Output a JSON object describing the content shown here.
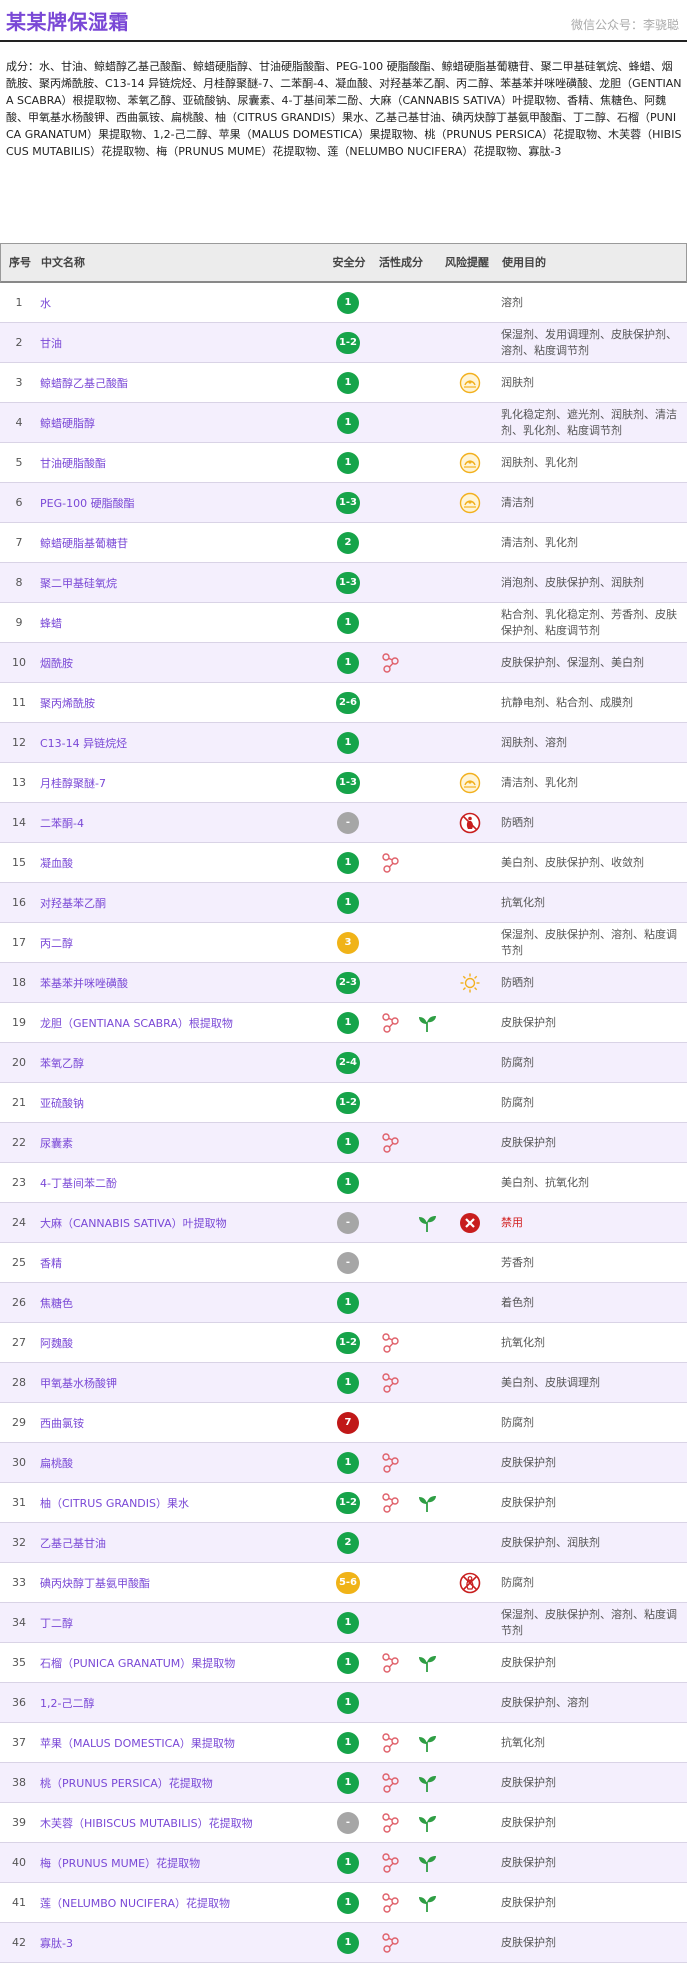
{
  "header": {
    "title": "某某牌保湿霜",
    "credit": "微信公众号：李骁聪"
  },
  "ingredients_text": "成分：水、甘油、鲸蜡醇乙基己酸酯、鲸蜡硬脂醇、甘油硬脂酸酯、PEG-100 硬脂酸酯、鲸蜡硬脂基葡糖苷、聚二甲基硅氧烷、蜂蜡、烟酰胺、聚丙烯酰胺、C13-14 异链烷烃、月桂醇聚醚-7、二苯酮-4、凝血酸、对羟基苯乙酮、丙二醇、苯基苯并咪唑磺酸、龙胆（GENTIANA SCABRA）根提取物、苯氧乙醇、亚硫酸钠、尿囊素、4-丁基间苯二酚、大麻（CANNABIS SATIVA）叶提取物、香精、焦糖色、阿魏酸、甲氧基水杨酸钾、西曲氯铵、扁桃酸、柚（CITRUS GRANDIS）果水、乙基己基甘油、碘丙炔醇丁基氨甲酸酯、丁二醇、石榴（PUNICA GRANATUM）果提取物、1,2-己二醇、苹果（MALUS DOMESTICA）果提取物、桃（PRUNUS PERSICA）花提取物、木芙蓉（HIBISCUS MUTABILIS）花提取物、梅（PRUNUS MUME）花提取物、莲（NELUMBO NUCIFERA）花提取物、寡肽-3",
  "columns": {
    "no": "序号",
    "name": "中文名称",
    "score": "安全分",
    "active": "活性成分",
    "risk": "风险提醒",
    "purpose": "使用目的"
  },
  "colors": {
    "accent": "#7a48d6",
    "green": "#16a44a",
    "gray": "#a6a6a6",
    "yellow": "#f0b318",
    "red": "#c01818",
    "ban": "#d22222"
  },
  "rows": [
    {
      "no": "1",
      "name": "水",
      "score": "1",
      "score_color": "green",
      "active": [],
      "risk": "",
      "purpose": "溶剂"
    },
    {
      "no": "2",
      "name": "甘油",
      "score": "1-2",
      "score_color": "green",
      "active": [],
      "risk": "",
      "purpose": "保湿剂、发用调理剂、皮肤保护剂、溶剂、粘度调节剂"
    },
    {
      "no": "3",
      "name": "鲸蜡醇乙基己酸酯",
      "score": "1",
      "score_color": "green",
      "active": [],
      "risk": "acne-icon",
      "purpose": "润肤剂"
    },
    {
      "no": "4",
      "name": "鲸蜡硬脂醇",
      "score": "1",
      "score_color": "green",
      "active": [],
      "risk": "",
      "purpose": "乳化稳定剂、遮光剂、润肤剂、清洁剂、乳化剂、粘度调节剂"
    },
    {
      "no": "5",
      "name": "甘油硬脂酸酯",
      "score": "1",
      "score_color": "green",
      "active": [],
      "risk": "acne-icon",
      "purpose": "润肤剂、乳化剂"
    },
    {
      "no": "6",
      "name": "PEG-100 硬脂酸酯",
      "score": "1-3",
      "score_color": "green",
      "active": [],
      "risk": "acne-icon",
      "purpose": "清洁剂"
    },
    {
      "no": "7",
      "name": "鲸蜡硬脂基葡糖苷",
      "score": "2",
      "score_color": "green",
      "active": [],
      "risk": "",
      "purpose": "清洁剂、乳化剂"
    },
    {
      "no": "8",
      "name": "聚二甲基硅氧烷",
      "score": "1-3",
      "score_color": "green",
      "active": [],
      "risk": "",
      "purpose": "消泡剂、皮肤保护剂、润肤剂"
    },
    {
      "no": "9",
      "name": "蜂蜡",
      "score": "1",
      "score_color": "green",
      "active": [],
      "risk": "",
      "purpose": "粘合剂、乳化稳定剂、芳香剂、皮肤保护剂、粘度调节剂"
    },
    {
      "no": "10",
      "name": "烟酰胺",
      "score": "1",
      "score_color": "green",
      "active": [
        "molecule-icon"
      ],
      "risk": "",
      "purpose": "皮肤保护剂、保湿剂、美白剂"
    },
    {
      "no": "11",
      "name": "聚丙烯酰胺",
      "score": "2-6",
      "score_color": "green",
      "active": [],
      "risk": "",
      "purpose": "抗静电剂、粘合剂、成膜剂"
    },
    {
      "no": "12",
      "name": "C13-14 异链烷烃",
      "score": "1",
      "score_color": "green",
      "active": [],
      "risk": "",
      "purpose": "润肤剂、溶剂"
    },
    {
      "no": "13",
      "name": "月桂醇聚醚-7",
      "score": "1-3",
      "score_color": "green",
      "active": [],
      "risk": "acne-icon",
      "purpose": "清洁剂、乳化剂"
    },
    {
      "no": "14",
      "name": "二苯酮-4",
      "score": "-",
      "score_color": "gray",
      "active": [],
      "risk": "pregnancy-warning-icon",
      "purpose": "防晒剂"
    },
    {
      "no": "15",
      "name": "凝血酸",
      "score": "1",
      "score_color": "green",
      "active": [
        "molecule-icon"
      ],
      "risk": "",
      "purpose": "美白剂、皮肤保护剂、收敛剂"
    },
    {
      "no": "16",
      "name": "对羟基苯乙酮",
      "score": "1",
      "score_color": "green",
      "active": [],
      "risk": "",
      "purpose": "抗氧化剂"
    },
    {
      "no": "17",
      "name": "丙二醇",
      "score": "3",
      "score_color": "yellow",
      "active": [],
      "risk": "",
      "purpose": "保湿剂、皮肤保护剂、溶剂、粘度调节剂"
    },
    {
      "no": "18",
      "name": "苯基苯并咪唑磺酸",
      "score": "2-3",
      "score_color": "green",
      "active": [],
      "risk": "sun-icon",
      "purpose": "防晒剂"
    },
    {
      "no": "19",
      "name": "龙胆（GENTIANA SCABRA）根提取物",
      "score": "1",
      "score_color": "green",
      "active": [
        "molecule-icon",
        "plant-icon"
      ],
      "risk": "",
      "purpose": "皮肤保护剂"
    },
    {
      "no": "20",
      "name": "苯氧乙醇",
      "score": "2-4",
      "score_color": "green",
      "active": [],
      "risk": "",
      "purpose": "防腐剂"
    },
    {
      "no": "21",
      "name": "亚硫酸钠",
      "score": "1-2",
      "score_color": "green",
      "active": [],
      "risk": "",
      "purpose": "防腐剂"
    },
    {
      "no": "22",
      "name": "尿囊素",
      "score": "1",
      "score_color": "green",
      "active": [
        "molecule-icon"
      ],
      "risk": "",
      "purpose": "皮肤保护剂"
    },
    {
      "no": "23",
      "name": "4-丁基间苯二酚",
      "score": "1",
      "score_color": "green",
      "active": [],
      "risk": "",
      "purpose": "美白剂、抗氧化剂"
    },
    {
      "no": "24",
      "name": "大麻（CANNABIS SATIVA）叶提取物",
      "score": "-",
      "score_color": "gray",
      "active": [
        "",
        "plant-icon"
      ],
      "risk": "banned-icon",
      "purpose": "禁用",
      "ban": true
    },
    {
      "no": "25",
      "name": "香精",
      "score": "-",
      "score_color": "gray",
      "active": [],
      "risk": "",
      "purpose": "芳香剂"
    },
    {
      "no": "26",
      "name": "焦糖色",
      "score": "1",
      "score_color": "green",
      "active": [],
      "risk": "",
      "purpose": "着色剂"
    },
    {
      "no": "27",
      "name": "阿魏酸",
      "score": "1-2",
      "score_color": "green",
      "active": [
        "molecule-icon"
      ],
      "risk": "",
      "purpose": "抗氧化剂"
    },
    {
      "no": "28",
      "name": "甲氧基水杨酸钾",
      "score": "1",
      "score_color": "green",
      "active": [
        "molecule-icon"
      ],
      "risk": "",
      "purpose": "美白剂、皮肤调理剂"
    },
    {
      "no": "29",
      "name": "西曲氯铵",
      "score": "7",
      "score_color": "red",
      "active": [],
      "risk": "",
      "purpose": "防腐剂"
    },
    {
      "no": "30",
      "name": "扁桃酸",
      "score": "1",
      "score_color": "green",
      "active": [
        "molecule-icon"
      ],
      "risk": "",
      "purpose": "皮肤保护剂"
    },
    {
      "no": "31",
      "name": "柚（CITRUS GRANDIS）果水",
      "score": "1-2",
      "score_color": "green",
      "active": [
        "molecule-icon",
        "plant-icon"
      ],
      "risk": "",
      "purpose": "皮肤保护剂"
    },
    {
      "no": "32",
      "name": "乙基己基甘油",
      "score": "2",
      "score_color": "green",
      "active": [],
      "risk": "",
      "purpose": "皮肤保护剂、润肤剂"
    },
    {
      "no": "33",
      "name": "碘丙炔醇丁基氨甲酸酯",
      "score": "5-6",
      "score_color": "yellow",
      "active": [],
      "risk": "no-pregnancy-icon",
      "purpose": "防腐剂"
    },
    {
      "no": "34",
      "name": "丁二醇",
      "score": "1",
      "score_color": "green",
      "active": [],
      "risk": "",
      "purpose": "保湿剂、皮肤保护剂、溶剂、粘度调节剂"
    },
    {
      "no": "35",
      "name": "石榴（PUNICA GRANATUM）果提取物",
      "score": "1",
      "score_color": "green",
      "active": [
        "molecule-icon",
        "plant-icon"
      ],
      "risk": "",
      "purpose": "皮肤保护剂"
    },
    {
      "no": "36",
      "name": "1,2-己二醇",
      "score": "1",
      "score_color": "green",
      "active": [],
      "risk": "",
      "purpose": "皮肤保护剂、溶剂"
    },
    {
      "no": "37",
      "name": "苹果（MALUS DOMESTICA）果提取物",
      "score": "1",
      "score_color": "green",
      "active": [
        "molecule-icon",
        "plant-icon"
      ],
      "risk": "",
      "purpose": "抗氧化剂"
    },
    {
      "no": "38",
      "name": "桃（PRUNUS PERSICA）花提取物",
      "score": "1",
      "score_color": "green",
      "active": [
        "molecule-icon",
        "plant-icon"
      ],
      "risk": "",
      "purpose": "皮肤保护剂"
    },
    {
      "no": "39",
      "name": "木芙蓉（HIBISCUS MUTABILIS）花提取物",
      "score": "-",
      "score_color": "gray",
      "active": [
        "molecule-icon",
        "plant-icon"
      ],
      "risk": "",
      "purpose": "皮肤保护剂"
    },
    {
      "no": "40",
      "name": "梅（PRUNUS MUME）花提取物",
      "score": "1",
      "score_color": "green",
      "active": [
        "molecule-icon",
        "plant-icon"
      ],
      "risk": "",
      "purpose": "皮肤保护剂"
    },
    {
      "no": "41",
      "name": "莲（NELUMBO NUCIFERA）花提取物",
      "score": "1",
      "score_color": "green",
      "active": [
        "molecule-icon",
        "plant-icon"
      ],
      "risk": "",
      "purpose": "皮肤保护剂"
    },
    {
      "no": "42",
      "name": "寡肽-3",
      "score": "1",
      "score_color": "green",
      "active": [
        "molecule-icon"
      ],
      "risk": "",
      "purpose": "皮肤保护剂"
    }
  ]
}
